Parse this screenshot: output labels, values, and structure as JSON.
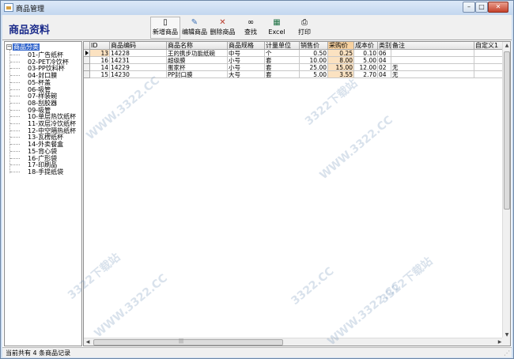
{
  "window": {
    "title": "商品管理",
    "controls": {
      "minimize": "–",
      "maximize": "□",
      "close": "✕"
    }
  },
  "header": {
    "page_title": "商品资料",
    "toolbar": [
      {
        "label": "新增商品",
        "icon": "new-document-icon"
      },
      {
        "label": "编辑商品",
        "icon": "edit-document-icon"
      },
      {
        "label": "删除商品",
        "icon": "delete-document-icon"
      },
      {
        "label": "查找",
        "icon": "binoculars-icon"
      },
      {
        "label": "Excel",
        "icon": "excel-icon"
      },
      {
        "label": "打印",
        "icon": "printer-icon"
      }
    ]
  },
  "tree": {
    "root_label": "商品分类",
    "expander": "−",
    "items": [
      "01-广告纸杯",
      "02-PET冷饮杯",
      "03-PP饮料杯",
      "04-封口膜",
      "05-杯盖",
      "06-吸管",
      "07-样装碗",
      "08-刮胶器",
      "09-吸管",
      "10-单层热饮纸杯",
      "11-双层冷饮纸杯",
      "12-中空隔热纸杯",
      "13-瓦楞纸杯",
      "14-外卖餐盒",
      "15-背心袋",
      "16-广形袋",
      "17-印刷品",
      "18-手提纸袋"
    ]
  },
  "grid": {
    "columns": [
      "ID",
      "商品编码",
      "商品名称",
      "商品规格",
      "计量单位",
      "销售价",
      "采购价",
      "成本价",
      "类别",
      "备注",
      "自定义1"
    ],
    "rows": [
      {
        "id": "13",
        "code": "14228",
        "name": "王的携步功能纸碗",
        "spec": "中号",
        "unit": "个",
        "sale": "0.50",
        "purchase": "0.25",
        "cost": "0.10",
        "category": "06",
        "note": "",
        "custom": ""
      },
      {
        "id": "16",
        "code": "14231",
        "name": "超级膜",
        "spec": "小号",
        "unit": "套",
        "sale": "10.00",
        "purchase": "8.00",
        "cost": "5.00",
        "category": "04",
        "note": "",
        "custom": ""
      },
      {
        "id": "14",
        "code": "14229",
        "name": "蛋家杯",
        "spec": "小号",
        "unit": "套",
        "sale": "25.00",
        "purchase": "15.00",
        "cost": "12.00",
        "category": "02",
        "note": "无",
        "custom": ""
      },
      {
        "id": "15",
        "code": "14230",
        "name": "PP封口膜",
        "spec": "大号",
        "unit": "套",
        "sale": "5.00",
        "purchase": "3.55",
        "cost": "2.70",
        "category": "04",
        "note": "无",
        "custom": ""
      }
    ],
    "scroll": {
      "up": "▲",
      "down": "▼",
      "left": "◀",
      "right": "▶",
      "grip": "|||"
    }
  },
  "status": {
    "text": "当前共有 4 条商品记录"
  }
}
